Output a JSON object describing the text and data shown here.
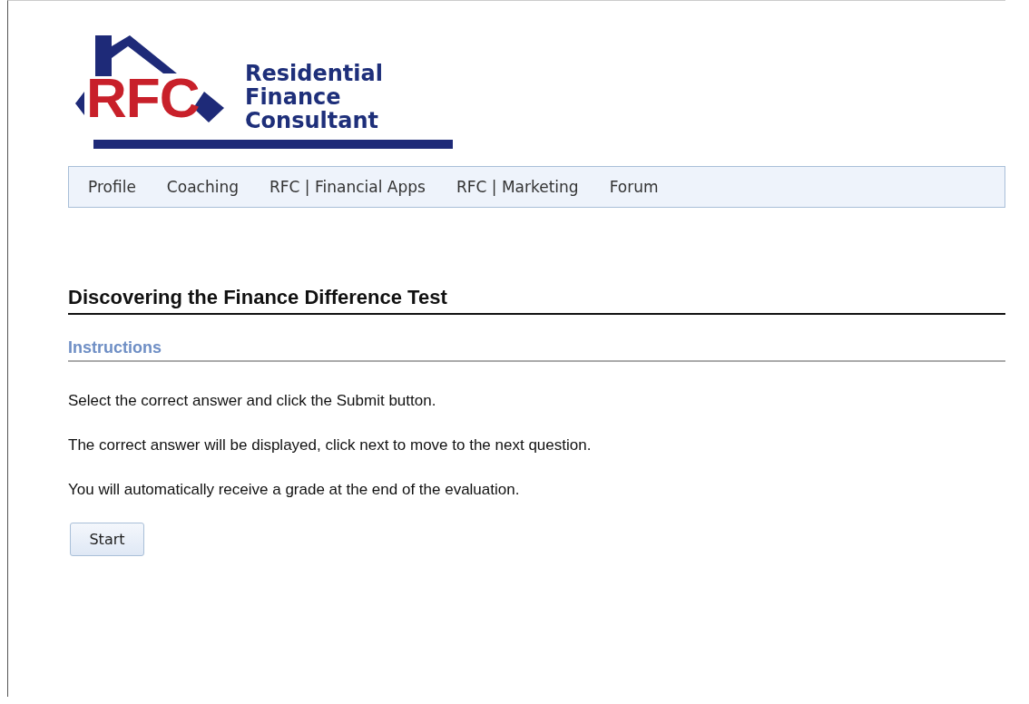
{
  "logo": {
    "initials": "RFC",
    "name_lines": [
      "Residential",
      "Finance",
      "Consultant"
    ]
  },
  "nav": {
    "items": [
      {
        "label": "Profile"
      },
      {
        "label": "Coaching"
      },
      {
        "label": "RFC | Financial Apps"
      },
      {
        "label": "RFC | Marketing"
      },
      {
        "label": "Forum"
      }
    ]
  },
  "title": "Discovering the Finance Difference Test",
  "section": {
    "heading": "Instructions",
    "paragraphs": [
      "Select the correct answer and click the Submit button.",
      "The correct answer will be displayed, click next to move to the next question.",
      "You will automatically receive a grade at the end of the evaluation."
    ]
  },
  "buttons": [
    "Start"
  ]
}
